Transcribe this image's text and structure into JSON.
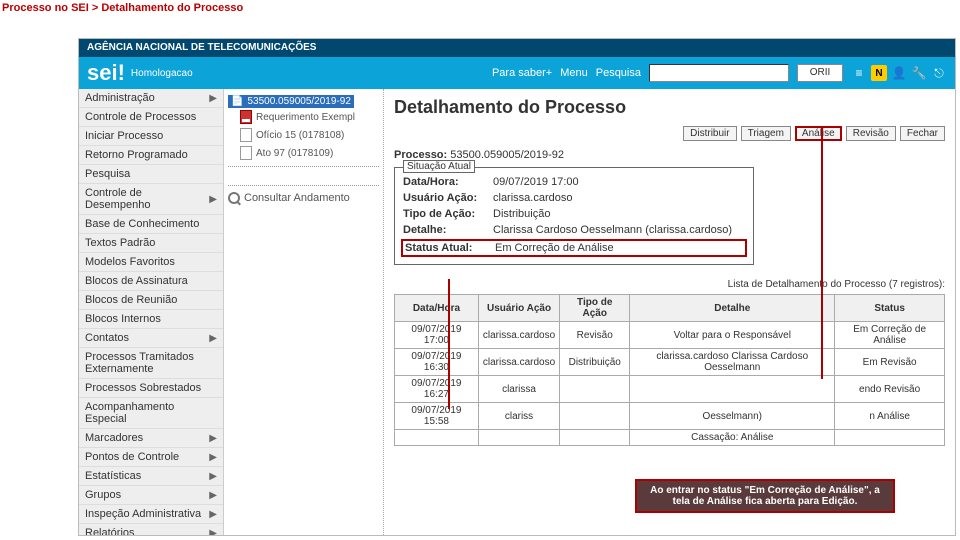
{
  "breadcrumb": "Processo no SEI > Detalhamento do Processo",
  "agency": "AGÊNCIA NACIONAL DE TELECOMUNICAÇÕES",
  "logo_text": "sei!",
  "logo_sub": "Homologacao",
  "topbar": {
    "parasaber": "Para saber+",
    "menu": "Menu",
    "pesquisa": "Pesquisa",
    "unit": "ORII"
  },
  "sidebar": [
    {
      "label": "Administração",
      "ar": true
    },
    {
      "label": "Controle de Processos",
      "ar": false
    },
    {
      "label": "Iniciar Processo",
      "ar": false
    },
    {
      "label": "Retorno Programado",
      "ar": false
    },
    {
      "label": "Pesquisa",
      "ar": false
    },
    {
      "label": "Controle de Desempenho",
      "ar": true
    },
    {
      "label": "Base de Conhecimento",
      "ar": false
    },
    {
      "label": "Textos Padrão",
      "ar": false
    },
    {
      "label": "Modelos Favoritos",
      "ar": false
    },
    {
      "label": "Blocos de Assinatura",
      "ar": false
    },
    {
      "label": "Blocos de Reunião",
      "ar": false
    },
    {
      "label": "Blocos Internos",
      "ar": false
    },
    {
      "label": "Contatos",
      "ar": true
    },
    {
      "label": "Processos Tramitados Externamente",
      "ar": false
    },
    {
      "label": "Processos Sobrestados",
      "ar": false
    },
    {
      "label": "Acompanhamento Especial",
      "ar": false
    },
    {
      "label": "Marcadores",
      "ar": true
    },
    {
      "label": "Pontos de Controle",
      "ar": true
    },
    {
      "label": "Estatísticas",
      "ar": true
    },
    {
      "label": "Grupos",
      "ar": true
    },
    {
      "label": "Inspeção Administrativa",
      "ar": true
    },
    {
      "label": "Relatórios",
      "ar": true
    }
  ],
  "tree": {
    "process": "53500.059005/2019-92",
    "docs": [
      "Requerimento Exempl",
      "Ofício 15 (0178108)",
      "Ato 97 (0178109)"
    ],
    "consult": "Consultar Andamento"
  },
  "detail": {
    "title": "Detalhamento do Processo",
    "buttons": [
      "Distribuir",
      "Triagem",
      "Análise",
      "Revisão",
      "Fechar"
    ],
    "process_lbl": "Processo:",
    "process_val": "53500.059005/2019-92",
    "situacao": {
      "legend": "Situação Atual",
      "rows": [
        {
          "lab": "Data/Hora:",
          "val": "09/07/2019 17:00"
        },
        {
          "lab": "Usuário Ação:",
          "val": "clarissa.cardoso"
        },
        {
          "lab": "Tipo de Ação:",
          "val": "Distribuição"
        },
        {
          "lab": "Detalhe:",
          "val": "Clarissa Cardoso Oesselmann (clarissa.cardoso)"
        },
        {
          "lab": "Status Atual:",
          "val": "Em Correção de Análise"
        }
      ]
    },
    "listinfo": "Lista de Detalhamento do Processo (7 registros):",
    "thead": [
      "Data/Hora",
      "Usuário Ação",
      "Tipo de Ação",
      "Detalhe",
      "Status"
    ],
    "rows": [
      {
        "dh": "09/07/2019 17:00",
        "u": "clarissa.cardoso",
        "t": "Revisão",
        "d": "Voltar para o Responsável",
        "s": "Em Correção de Análise"
      },
      {
        "dh": "09/07/2019 16:30",
        "u": "clarissa.cardoso",
        "t": "Distribuição",
        "d": "clarissa.cardoso Clarissa Cardoso Oesselmann",
        "s": "Em Revisão"
      },
      {
        "dh": "09/07/2019 16:27",
        "u": "clarissa",
        "t": "",
        "d": "",
        "s": "endo Revisão"
      },
      {
        "dh": "09/07/2019 15:58",
        "u": "clariss",
        "t": "",
        "d": "Oesselmann)",
        "s": "n Análise"
      },
      {
        "dh": "",
        "u": "",
        "t": "",
        "d": "Cassação: Análise",
        "s": ""
      }
    ]
  },
  "callout": "Ao entrar no status \"Em Correção de Análise\", a tela de Análise fica aberta para Edição."
}
